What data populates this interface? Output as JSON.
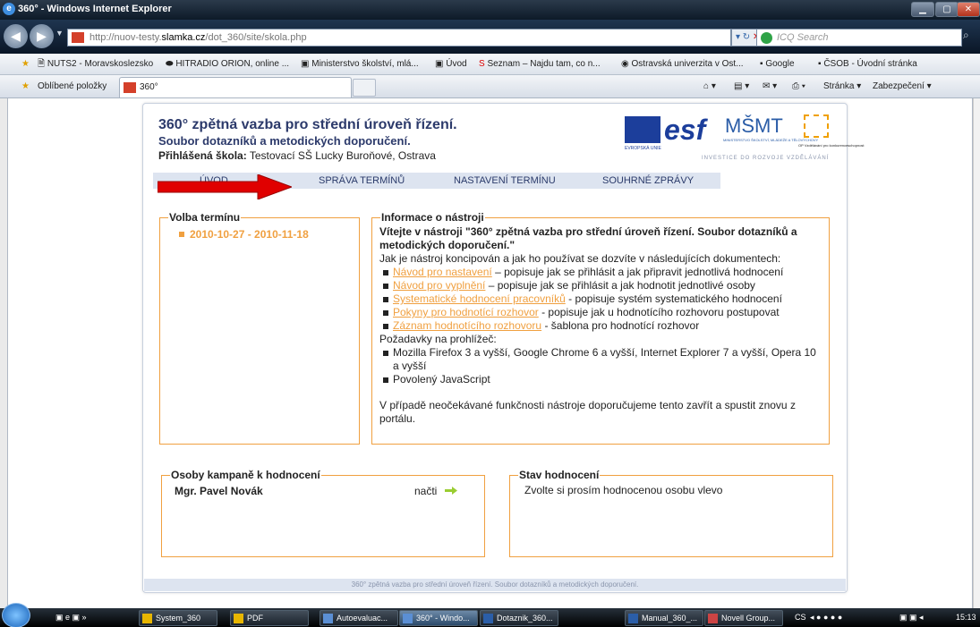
{
  "window": {
    "title": "360° - Windows Internet Explorer",
    "ie_glyph": "e"
  },
  "address": {
    "prefix": "http://nuov-testy.",
    "domain": "slamka.cz",
    "path": "/dot_360/site/skola.php",
    "search_placeholder": "ICQ Search"
  },
  "favorites_bar": {
    "items": [
      "NUTS2 - Moravskoslezsko",
      "HITRADIO ORION, online ...",
      "Ministerstvo školství, mlá...",
      "Úvod",
      "Seznam – Najdu tam, co n...",
      "Ostravská univerzita v Ost...",
      "Google",
      "ČSOB - Úvodní stránka"
    ]
  },
  "tabs_bar": {
    "favorites_label": "Oblíbené položky",
    "active_tab": "360°",
    "page_menu": "Stránka",
    "safety_menu": "Zabezpečení"
  },
  "header": {
    "title": "360° zpětná vazba pro střední úroveň řízení.",
    "subtitle": "Soubor dotazníků a metodických doporučení.",
    "school_label": "Přihlášená škola:",
    "school_name": " Testovací SŠ Lucky Buroňové, Ostrava",
    "logo_eu_text": "EVROPSKÁ UNIE",
    "logo_esf": "esf",
    "logo_msmt": "MŠMT",
    "logo_msmt_text": "MINISTERSTVO ŠKOLSTVÍ, MLÁDEŽE A TĚLOVÝCHOVY",
    "logo_op_text": "OP Vzdělávání pro konkurenceschopnost",
    "invest": "INVESTICE DO ROZVOJE VZDĚLÁVÁNÍ"
  },
  "menu": {
    "items": [
      "ÚVOD",
      "SPRÁVA TERMÍNŮ",
      "NASTAVENÍ TERMÍNU",
      "SOUHRNÉ ZPRÁVY"
    ]
  },
  "volba": {
    "legend": "Volba termínu",
    "term": "2010-10-27 - 2010-11-18"
  },
  "info": {
    "legend": "Informace o nástroji",
    "welcome": "Vítejte v nástroji \"360° zpětná vazba pro střední úroveň řízení. Soubor dotazníků a metodických doporučení.\"",
    "intro": "Jak je nástroj koncipován a jak ho používat se dozvíte v následujících dokumentech:",
    "docs": [
      {
        "link": "Návod pro nastavení",
        "text": " – popisuje jak se přihlásit a jak připravit jednotlivá hodnocení"
      },
      {
        "link": "Návod pro vyplnění",
        "text": " – popisuje jak se přihlásit a jak hodnotit jednotlivé osoby"
      },
      {
        "link": "Systematické hodnocení pracovníků",
        "text": " - popisuje systém systematického hodnocení"
      },
      {
        "link": "Pokyny pro hodnotící rozhovor",
        "text": " - popisuje jak u hodnotícího rozhovoru postupovat"
      },
      {
        "link": "Záznam hodnotícího rozhovoru",
        "text": " - šablona pro hodnotící rozhovor"
      }
    ],
    "req_title": "Požadavky na prohlížeč:",
    "reqs": [
      "Mozilla Firefox 3 a vyšší, Google Chrome 6 a vyšší, Internet Explorer 7 a vyšší, Opera 10 a vyšší",
      "Povolený JavaScript"
    ],
    "note": "V případě neočekávané funkčnosti nástroje doporučujeme tento zavřít a spustit znovu z portálu."
  },
  "osoby": {
    "legend": "Osoby kampaně k hodnocení",
    "person": "Mgr. Pavel Novák",
    "load": "načti"
  },
  "stav": {
    "legend": "Stav hodnocení",
    "text": "Zvolte si prosím hodnocenou osobu vlevo"
  },
  "footer": "360° zpětná vazba pro střední úroveň řízení. Soubor dotazníků a metodických doporučení.",
  "taskbar": {
    "items": [
      "System_360",
      "PDF",
      "Autoevaluac...",
      "360° - Windo...",
      "Dotaznik_360...",
      "Manual_360_...",
      "Novell Group..."
    ],
    "lang": "CS",
    "time": "15:13"
  },
  "colors": {
    "accent": "#f0a040",
    "title": "#2c3a6b",
    "menu_bg": "#dde4f0",
    "arrow": "#e00000"
  }
}
